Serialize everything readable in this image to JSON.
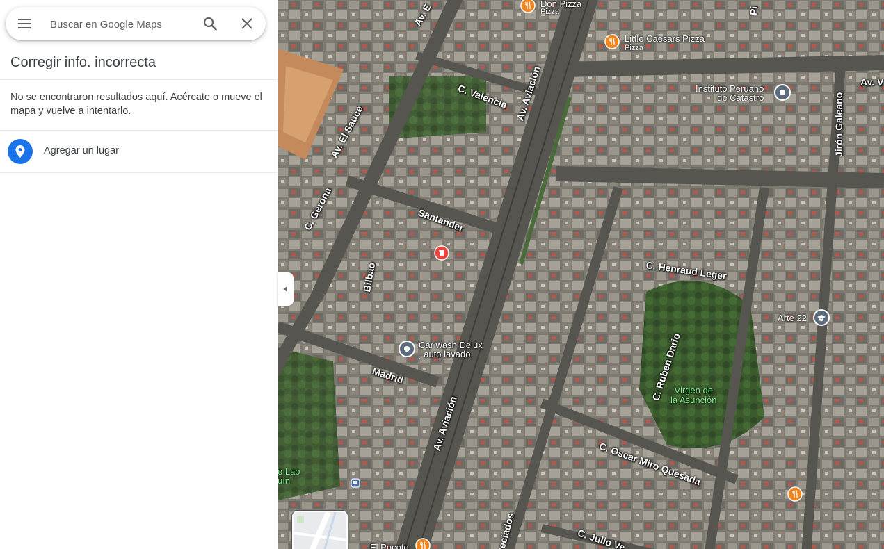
{
  "search": {
    "placeholder": "Buscar en Google Maps",
    "menu_icon": "menu-icon",
    "search_icon": "search-icon",
    "close_icon": "close-icon"
  },
  "panel": {
    "title": "Corregir info. incorrecta",
    "no_results": "No se encontraron resultados aquí. Acércate o mueve el mapa y vuelve a intentarlo.",
    "add_place_label": "Agregar un lugar",
    "add_place_icon": "location-pin-icon",
    "accent_color": "#1a73e8"
  },
  "map": {
    "streets": [
      "Av. Aviación",
      "Av. Aviación",
      "C. Valencia",
      "Av. El Sauce",
      "C. Gerona",
      "Santander",
      "Bilbao",
      "Madrid",
      "C. Henraud Leger",
      "C. Ruben Dario",
      "C. Oscar Miro Quesada",
      "C. Julio Ve",
      "Jirón Galeano",
      "Av. V",
      "Av. E",
      "Preciados",
      "Pi"
    ],
    "pois": {
      "don_pizza": {
        "name": "Don Pizza",
        "category": "Pizza"
      },
      "little_caesars": {
        "name": "Little Caesars Pizza",
        "category": "Pizza"
      },
      "instituto": {
        "name_line1": "Instituto Peruano",
        "name_line2": "de Catastro"
      },
      "arte22": {
        "name": "Arte 22"
      },
      "carwash": {
        "name_line1": "Car wash Delux",
        "name_line2": ", auto lavado"
      },
      "el_pocoto": {
        "name": "El Pocoto"
      },
      "lao": {
        "name_line1": "e Lao",
        "name_line2": "uín"
      }
    },
    "park": {
      "line1": "Virgen de",
      "line2": "la Asunción"
    },
    "colors": {
      "restaurant_marker": "#f2841d",
      "shop_marker": "#e8453c",
      "generic_marker": "#5b6b7b",
      "park_label": "#7cf08a"
    }
  }
}
